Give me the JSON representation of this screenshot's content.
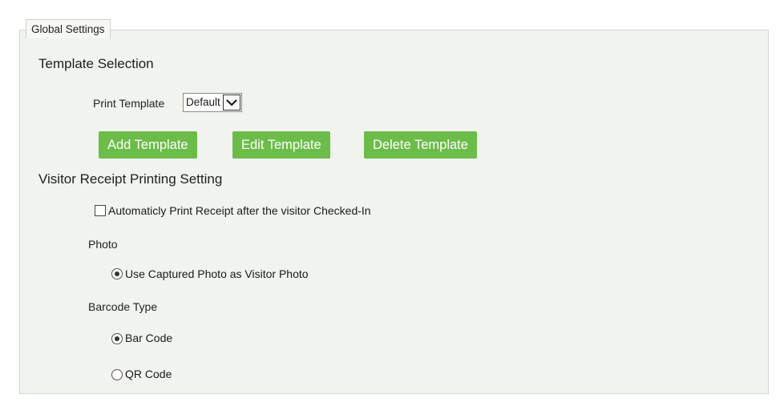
{
  "panel": {
    "tab_label": "Global Settings"
  },
  "template_selection": {
    "title": "Template Selection",
    "print_template_label": "Print Template",
    "print_template_value": "Default",
    "buttons": {
      "add": "Add Template",
      "edit": "Edit Template",
      "delete": "Delete Template"
    },
    "button_color": "#6cbc4a"
  },
  "receipt_printing": {
    "title": "Visitor Receipt Printing Setting",
    "auto_print_label": "Automaticly Print Receipt after the visitor Checked-In",
    "auto_print_checked": false,
    "photo": {
      "label": "Photo",
      "options": [
        {
          "label": "Use Captured Photo as Visitor Photo",
          "selected": true
        }
      ]
    },
    "barcode": {
      "label": "Barcode Type",
      "options": [
        {
          "label": "Bar Code",
          "selected": true
        },
        {
          "label": "QR Code",
          "selected": false
        }
      ]
    }
  }
}
